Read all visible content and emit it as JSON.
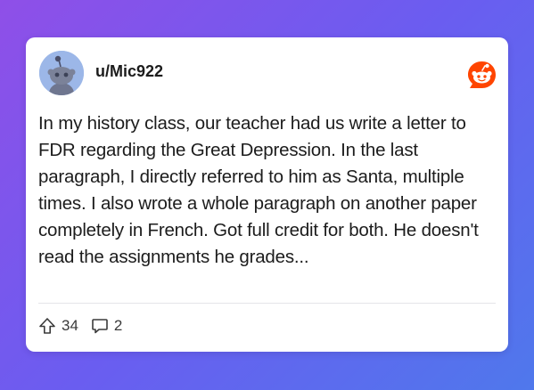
{
  "post": {
    "username": "u/Mic922",
    "body": "In my history class, our teacher had us write a letter to FDR regarding the Great Depression. In the last paragraph, I directly referred to him as Santa, multiple times. I also wrote a whole paragraph on another paper completely in French. Got full credit for both. He doesn't read the assignments he grades...",
    "upvotes": "34",
    "comments": "2"
  },
  "icons": {
    "avatar": "reddit-snoo-avatar",
    "logo": "reddit-logo-icon",
    "upvote": "upvote-arrow-icon",
    "comment": "comment-bubble-icon"
  },
  "colors": {
    "background_start": "#8f4fe8",
    "background_end": "#4f78ec",
    "reddit_orange": "#ff4500",
    "avatar_bg": "#9cb7e8"
  }
}
